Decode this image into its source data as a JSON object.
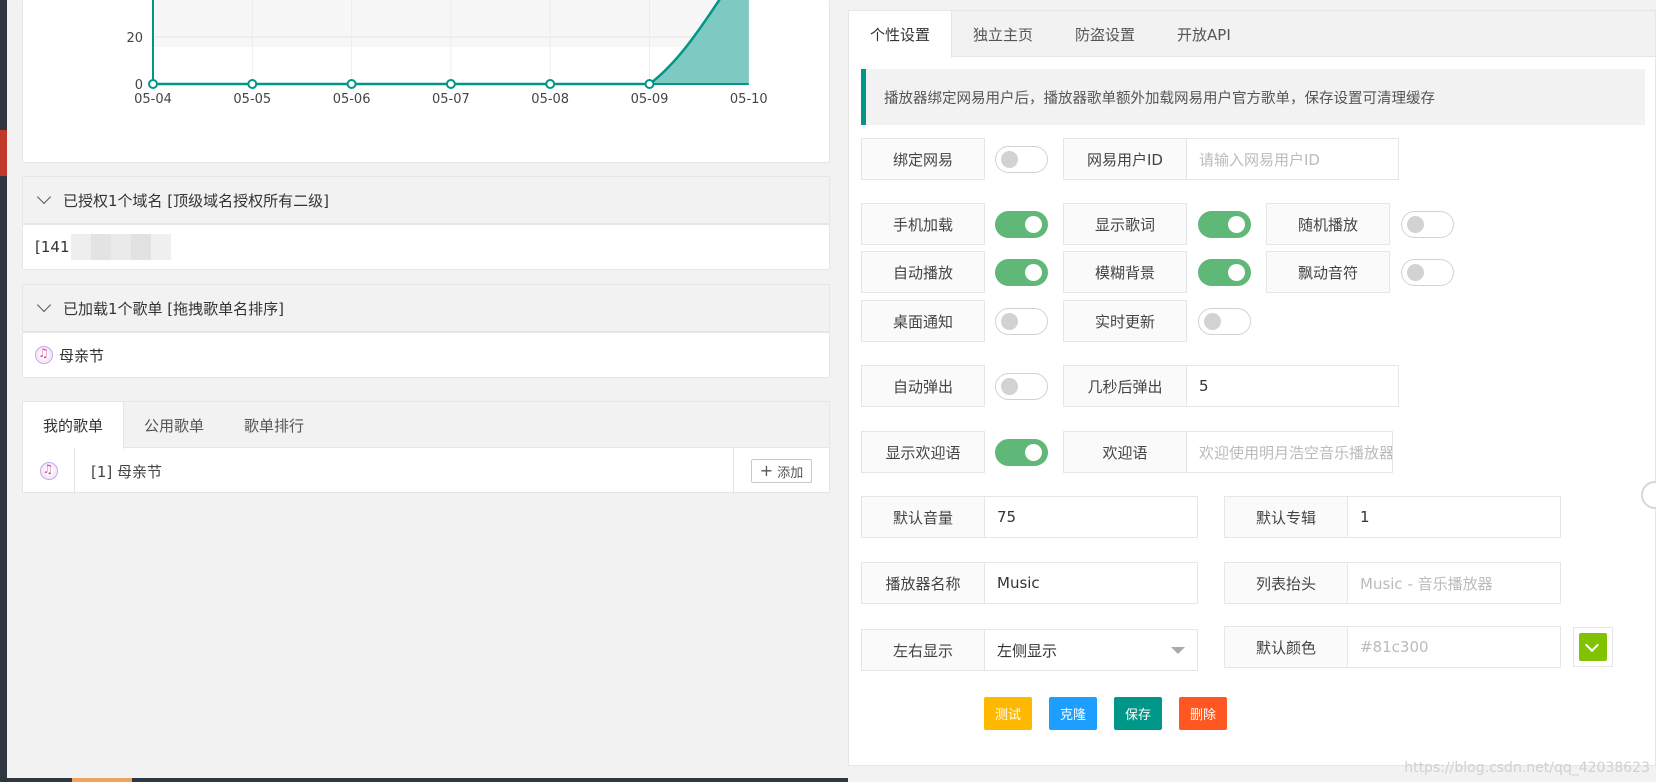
{
  "chart": {
    "y_ticks": [
      "0",
      "20"
    ],
    "x_ticks": [
      "05-04",
      "05-05",
      "05-06",
      "05-07",
      "05-08",
      "05-09",
      "05-10"
    ]
  },
  "chart_data": {
    "type": "area",
    "x": [
      "05-04",
      "05-05",
      "05-06",
      "05-07",
      "05-08",
      "05-09",
      "05-10"
    ],
    "values": [
      0,
      0,
      0,
      0,
      0,
      0,
      50
    ],
    "ylim": [
      0,
      40
    ],
    "grid": true,
    "colors": {
      "line": "#009688",
      "fill": "#7ecac2"
    }
  },
  "domains": {
    "title": "已授权1个域名 [顶级域名授权所有二级]",
    "item_prefix": "[141"
  },
  "loaded_playlists": {
    "title": "已加载1个歌单 [拖拽歌单名排序]",
    "item": "母亲节"
  },
  "playlist_tabs": {
    "tabs": [
      "我的歌单",
      "公用歌单",
      "歌单排行"
    ],
    "row_name": "[1] 母亲节",
    "add_label": "添加"
  },
  "settings": {
    "tabs": [
      "个性设置",
      "独立主页",
      "防盗设置",
      "开放API"
    ],
    "notice": "播放器绑定网易用户后，播放器歌单额外加载网易用户官方歌单，保存设置可清理缓存",
    "bind_netease": "绑定网易",
    "netease_id_label": "网易用户ID",
    "netease_id_placeholder": "请输入网易用户ID",
    "mobile_load": "手机加载",
    "show_lyrics": "显示歌词",
    "random_play": "随机播放",
    "auto_play": "自动播放",
    "blur_bg": "模糊背景",
    "float_notes": "飘动音符",
    "desktop_notify": "桌面通知",
    "live_update": "实时更新",
    "auto_popup": "自动弹出",
    "popup_delay_label": "几秒后弹出",
    "popup_delay_value": "5",
    "show_welcome": "显示欢迎语",
    "welcome_label": "欢迎语",
    "welcome_placeholder": "欢迎使用明月浩空音乐播放器",
    "default_volume_label": "默认音量",
    "default_volume_value": "75",
    "default_album_label": "默认专辑",
    "default_album_value": "1",
    "player_name_label": "播放器名称",
    "player_name_value": "Music",
    "list_header_label": "列表抬头",
    "list_header_placeholder": "Music - 音乐播放器",
    "side_label": "左右显示",
    "side_value": "左侧显示",
    "default_color_label": "默认颜色",
    "default_color_placeholder": "#81c300",
    "btn_test": "测试",
    "btn_clone": "克隆",
    "btn_save": "保存",
    "btn_delete": "删除"
  },
  "colors": {
    "accent": "#009688",
    "toggle_on": "#5fb878",
    "test": "#ffb800",
    "clone": "#1e9fff",
    "save": "#009688",
    "delete": "#ff5722",
    "swatch": "#81c300"
  },
  "watermark": "https://blog.csdn.net/qq_42038623"
}
